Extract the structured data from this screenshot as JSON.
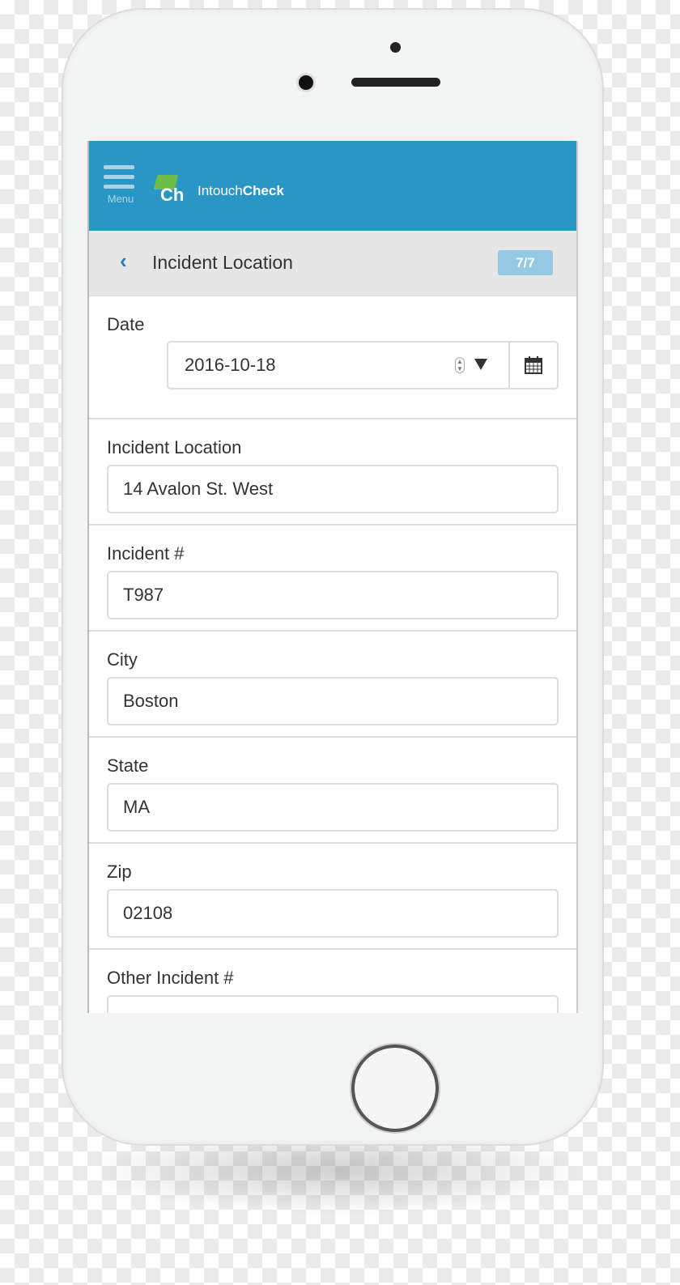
{
  "app": {
    "brand_prefix": "Intouch",
    "brand_suffix": "Check",
    "logo_text": "Ch",
    "menu_label": "Menu",
    "accent": "#2a96c6"
  },
  "subheader": {
    "title": "Incident Location",
    "progress": "7/7"
  },
  "fields": {
    "date": {
      "label": "Date",
      "value": "2016-10-18"
    },
    "location": {
      "label": "Incident Location",
      "value": "14 Avalon St. West"
    },
    "incident": {
      "label": "Incident #",
      "value": "T987"
    },
    "city": {
      "label": "City",
      "value": "Boston"
    },
    "state": {
      "label": "State",
      "value": "MA"
    },
    "zip": {
      "label": "Zip",
      "value": "02108"
    },
    "other": {
      "label": "Other Incident #",
      "value": ""
    }
  }
}
